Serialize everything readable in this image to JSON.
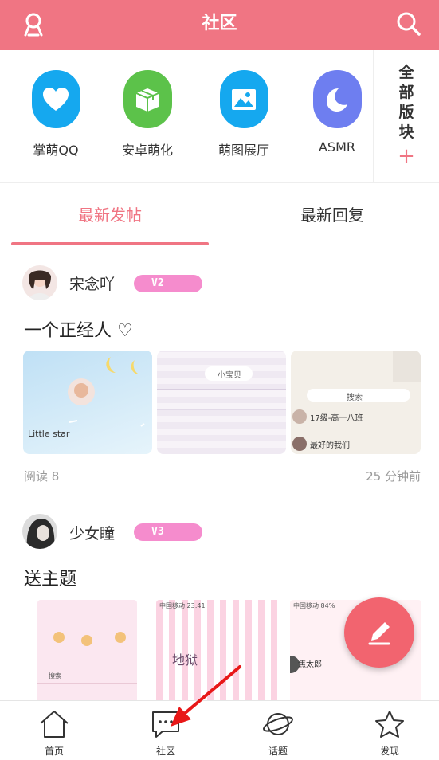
{
  "header": {
    "title": "社区"
  },
  "boards": [
    {
      "label": "掌萌QQ",
      "icon": "heart-icon",
      "color": "#15a8ef"
    },
    {
      "label": "安卓萌化",
      "icon": "package-icon",
      "color": "#5cc24a"
    },
    {
      "label": "萌图展厅",
      "icon": "image-icon",
      "color": "#15a8ef"
    },
    {
      "label": "ASMR",
      "icon": "face-icon",
      "color": "#6e7ef0"
    }
  ],
  "all_boards": {
    "label": "全部版块",
    "chars": [
      "全",
      "部",
      "版",
      "块"
    ],
    "plus": "+"
  },
  "tabs": [
    {
      "label": "最新发帖",
      "active": true
    },
    {
      "label": "最新回复",
      "active": false
    }
  ],
  "posts": [
    {
      "author": "宋念吖",
      "level": "V2",
      "title": "一个正经人 ♡",
      "thumbs": [
        {
          "text": "Little star"
        },
        {
          "text": "小宝贝"
        },
        {
          "text_lines": [
            "搜索",
            "17级-高一八班",
            "最好的我们"
          ]
        }
      ],
      "reads": "阅读 8",
      "time": "25 分钟前"
    },
    {
      "author": "少女瞳",
      "level": "V3",
      "title": "送主题",
      "thumbs": [
        {
          "text": "搜索"
        },
        {
          "text": "地狱",
          "status": "中国移动 23:41"
        },
        {
          "text": "焦太郎",
          "status": "中国移动 84%"
        }
      ]
    }
  ],
  "bottom_nav": [
    {
      "label": "首页",
      "icon": "home-icon"
    },
    {
      "label": "社区",
      "icon": "chat-bubble-icon"
    },
    {
      "label": "话题",
      "icon": "planet-icon"
    },
    {
      "label": "发现",
      "icon": "star-icon"
    }
  ],
  "colors": {
    "accent": "#f07583",
    "fab": "#f2646f",
    "level_badge": "#f58ccd"
  }
}
